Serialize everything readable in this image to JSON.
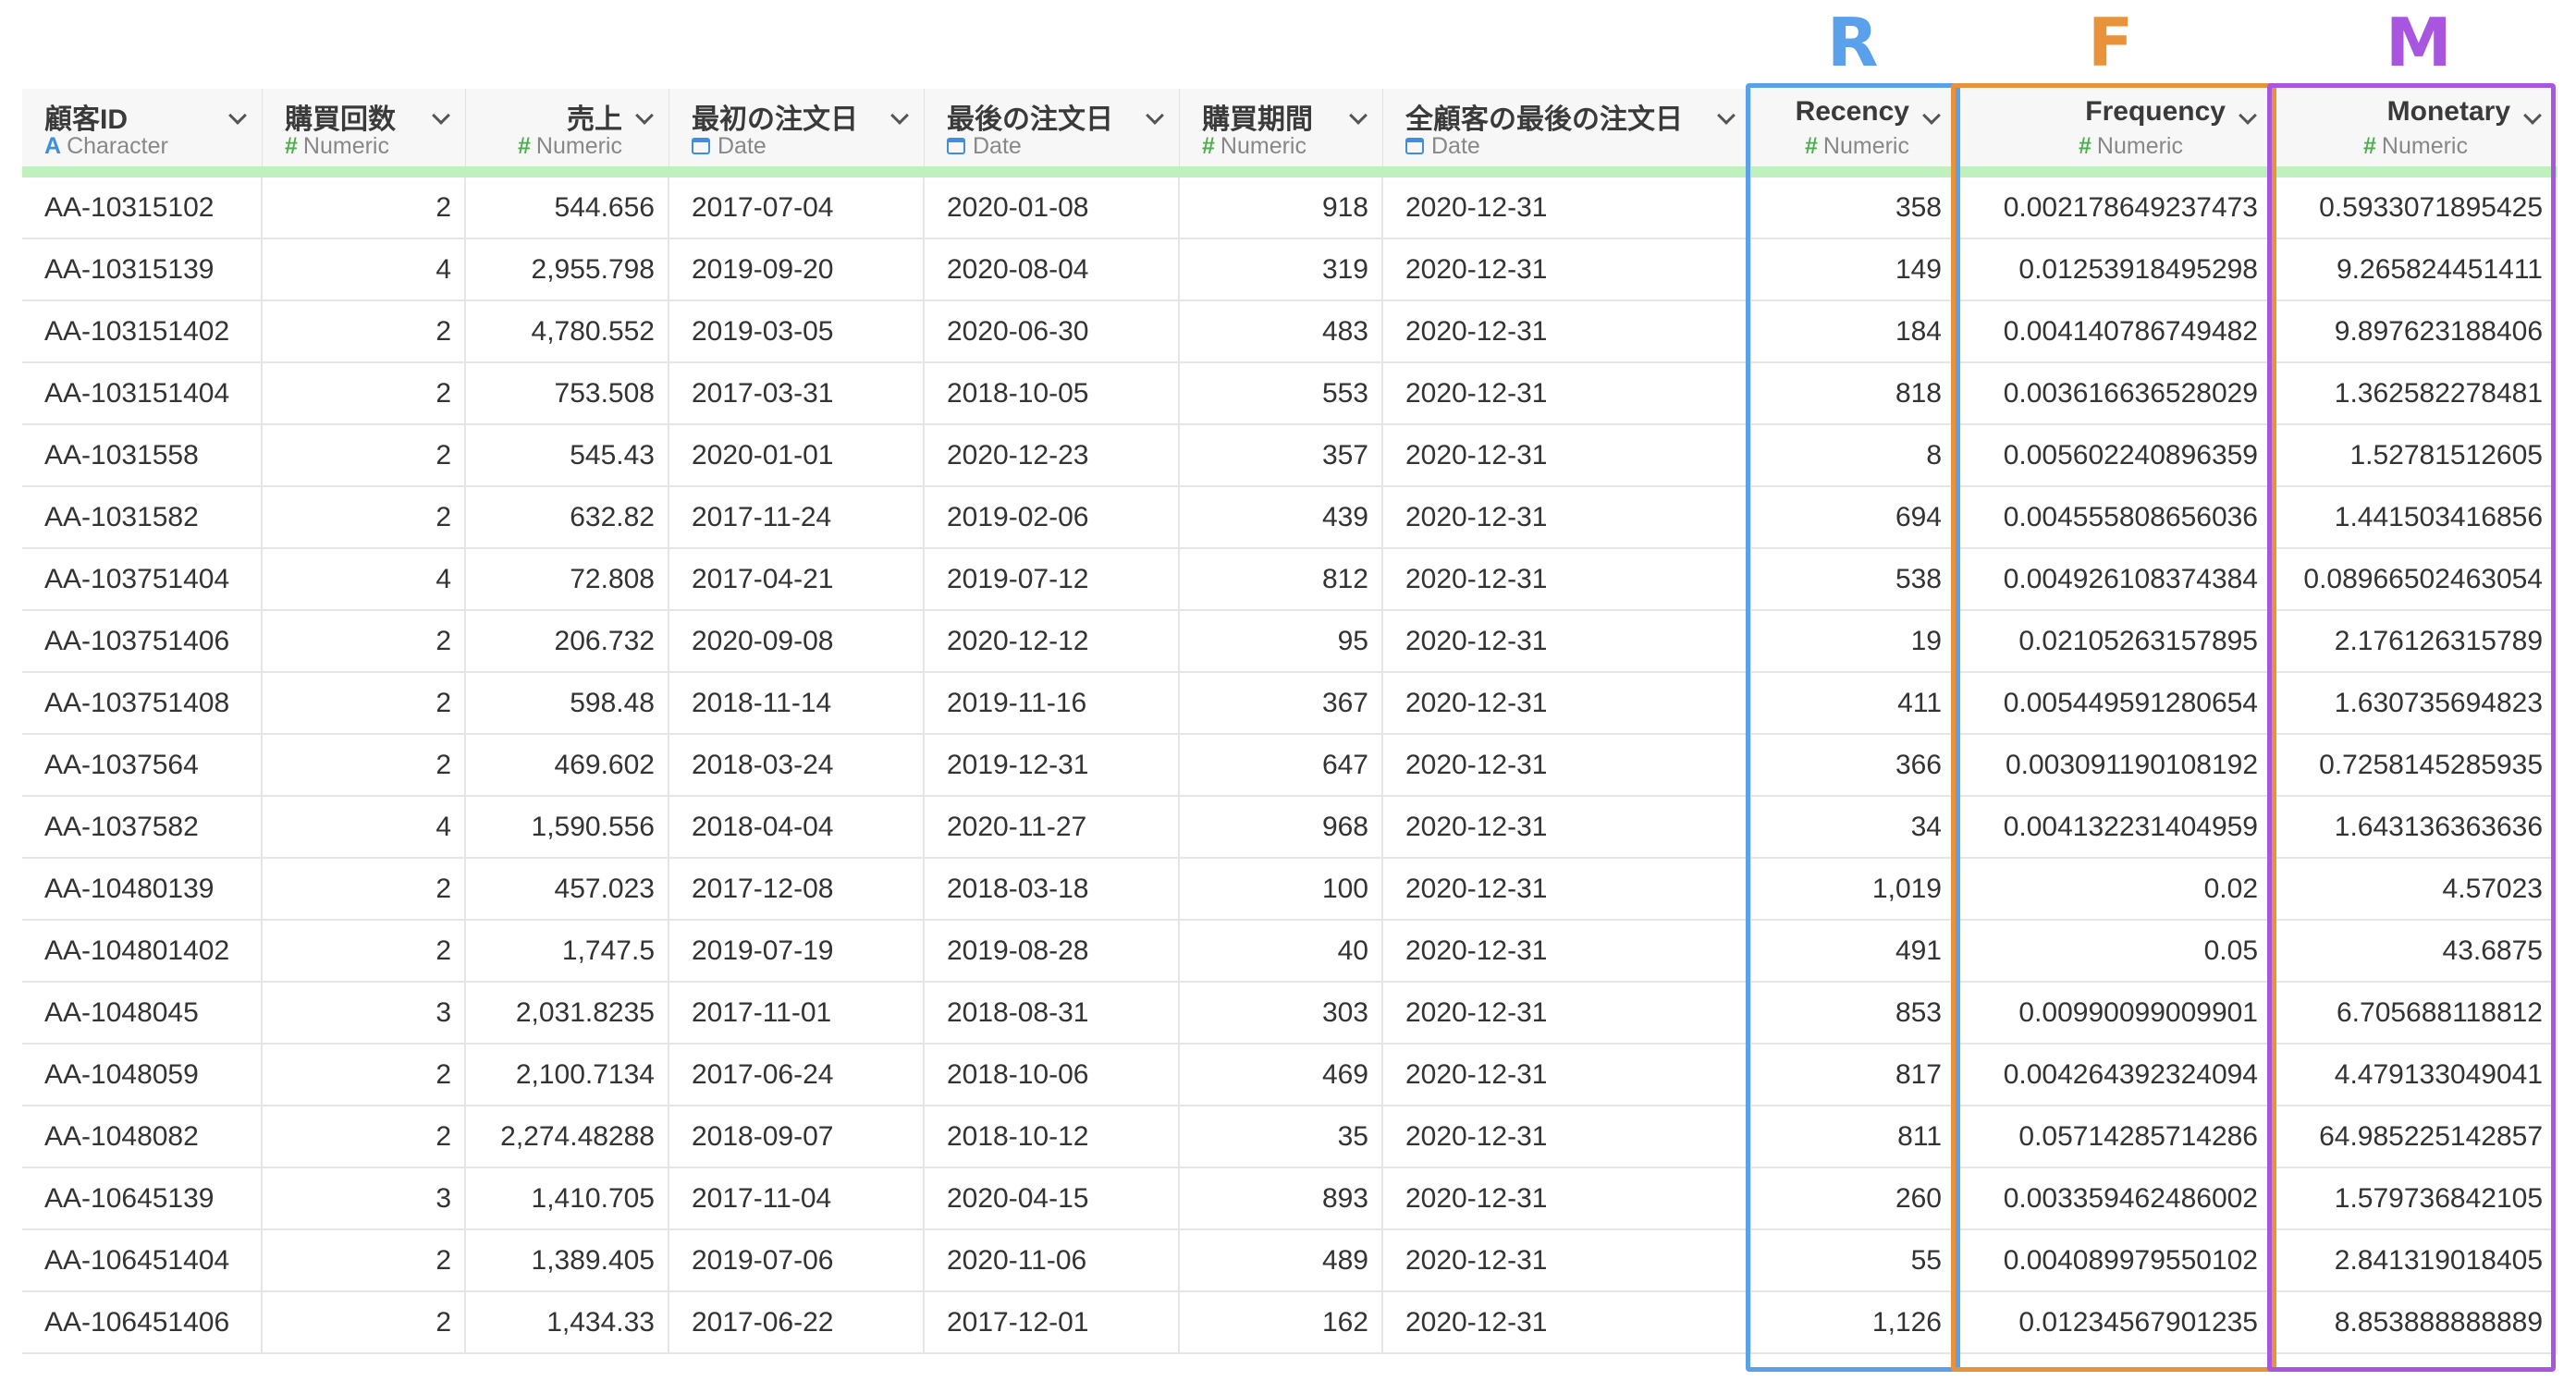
{
  "letters": {
    "r": "R",
    "f": "F",
    "m": "M"
  },
  "colors": {
    "recency": "#5aa0ea",
    "frequency": "#e8923a",
    "monetary": "#a855e0",
    "type_bar": "#bff0bd"
  },
  "columns": [
    {
      "name": "顧客ID",
      "type": "Character",
      "icon": "character-icon"
    },
    {
      "name": "購買回数",
      "type": "Numeric",
      "icon": "numeric-icon"
    },
    {
      "name": "売上",
      "type": "Numeric",
      "icon": "numeric-icon"
    },
    {
      "name": "最初の注文日",
      "type": "Date",
      "icon": "calendar-icon"
    },
    {
      "name": "最後の注文日",
      "type": "Date",
      "icon": "calendar-icon"
    },
    {
      "name": "購買期間",
      "type": "Numeric",
      "icon": "numeric-icon"
    },
    {
      "name": "全顧客の最後の注文日",
      "type": "Date",
      "icon": "calendar-icon"
    },
    {
      "name": "Recency",
      "type": "Numeric",
      "icon": "numeric-icon"
    },
    {
      "name": "Frequency",
      "type": "Numeric",
      "icon": "numeric-icon"
    },
    {
      "name": "Monetary",
      "type": "Numeric",
      "icon": "numeric-icon"
    }
  ],
  "rows": [
    [
      "AA-10315102",
      "2",
      "544.656",
      "2017-07-04",
      "2020-01-08",
      "918",
      "2020-12-31",
      "358",
      "0.002178649237473",
      "0.5933071895425"
    ],
    [
      "AA-10315139",
      "4",
      "2,955.798",
      "2019-09-20",
      "2020-08-04",
      "319",
      "2020-12-31",
      "149",
      "0.01253918495298",
      "9.265824451411"
    ],
    [
      "AA-103151402",
      "2",
      "4,780.552",
      "2019-03-05",
      "2020-06-30",
      "483",
      "2020-12-31",
      "184",
      "0.004140786749482",
      "9.897623188406"
    ],
    [
      "AA-103151404",
      "2",
      "753.508",
      "2017-03-31",
      "2018-10-05",
      "553",
      "2020-12-31",
      "818",
      "0.003616636528029",
      "1.362582278481"
    ],
    [
      "AA-1031558",
      "2",
      "545.43",
      "2020-01-01",
      "2020-12-23",
      "357",
      "2020-12-31",
      "8",
      "0.005602240896359",
      "1.52781512605"
    ],
    [
      "AA-1031582",
      "2",
      "632.82",
      "2017-11-24",
      "2019-02-06",
      "439",
      "2020-12-31",
      "694",
      "0.004555808656036",
      "1.441503416856"
    ],
    [
      "AA-103751404",
      "4",
      "72.808",
      "2017-04-21",
      "2019-07-12",
      "812",
      "2020-12-31",
      "538",
      "0.004926108374384",
      "0.08966502463054"
    ],
    [
      "AA-103751406",
      "2",
      "206.732",
      "2020-09-08",
      "2020-12-12",
      "95",
      "2020-12-31",
      "19",
      "0.02105263157895",
      "2.176126315789"
    ],
    [
      "AA-103751408",
      "2",
      "598.48",
      "2018-11-14",
      "2019-11-16",
      "367",
      "2020-12-31",
      "411",
      "0.005449591280654",
      "1.630735694823"
    ],
    [
      "AA-1037564",
      "2",
      "469.602",
      "2018-03-24",
      "2019-12-31",
      "647",
      "2020-12-31",
      "366",
      "0.003091190108192",
      "0.7258145285935"
    ],
    [
      "AA-1037582",
      "4",
      "1,590.556",
      "2018-04-04",
      "2020-11-27",
      "968",
      "2020-12-31",
      "34",
      "0.004132231404959",
      "1.643136363636"
    ],
    [
      "AA-10480139",
      "2",
      "457.023",
      "2017-12-08",
      "2018-03-18",
      "100",
      "2020-12-31",
      "1,019",
      "0.02",
      "4.57023"
    ],
    [
      "AA-104801402",
      "2",
      "1,747.5",
      "2019-07-19",
      "2019-08-28",
      "40",
      "2020-12-31",
      "491",
      "0.05",
      "43.6875"
    ],
    [
      "AA-1048045",
      "3",
      "2,031.8235",
      "2017-11-01",
      "2018-08-31",
      "303",
      "2020-12-31",
      "853",
      "0.00990099009901",
      "6.705688118812"
    ],
    [
      "AA-1048059",
      "2",
      "2,100.7134",
      "2017-06-24",
      "2018-10-06",
      "469",
      "2020-12-31",
      "817",
      "0.004264392324094",
      "4.479133049041"
    ],
    [
      "AA-1048082",
      "2",
      "2,274.48288",
      "2018-09-07",
      "2018-10-12",
      "35",
      "2020-12-31",
      "811",
      "0.05714285714286",
      "64.985225142857"
    ],
    [
      "AA-10645139",
      "3",
      "1,410.705",
      "2017-11-04",
      "2020-04-15",
      "893",
      "2020-12-31",
      "260",
      "0.003359462486002",
      "1.579736842105"
    ],
    [
      "AA-106451404",
      "2",
      "1,389.405",
      "2019-07-06",
      "2020-11-06",
      "489",
      "2020-12-31",
      "55",
      "0.004089979550102",
      "2.841319018405"
    ],
    [
      "AA-106451406",
      "2",
      "1,434.33",
      "2017-06-22",
      "2017-12-01",
      "162",
      "2020-12-31",
      "1,126",
      "0.01234567901235",
      "8.853888888889"
    ]
  ]
}
